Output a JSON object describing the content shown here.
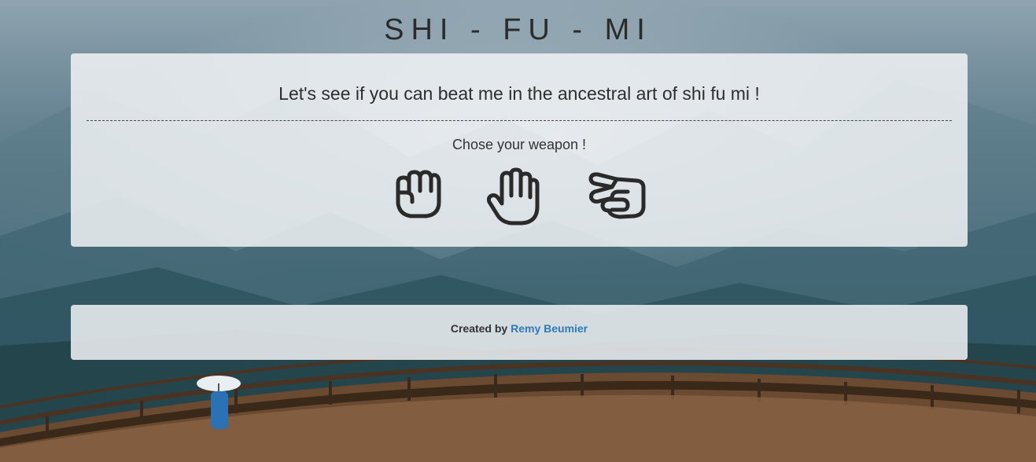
{
  "header": {
    "title": "SHI - FU - MI"
  },
  "game": {
    "intro": "Let's see if you can beat me in the ancestral art of shi fu mi !",
    "prompt": "Chose your weapon !",
    "weapons": [
      {
        "name": "rock",
        "icon": "fist-icon"
      },
      {
        "name": "paper",
        "icon": "open-hand-icon"
      },
      {
        "name": "scissors",
        "icon": "scissors-hand-icon"
      }
    ]
  },
  "footer": {
    "prefix": "Created by",
    "author": "Remy Beumier"
  },
  "colors": {
    "link": "#2e7ab6",
    "panel": "rgba(240,242,245,0.86)",
    "icon": "#2a2a2a"
  }
}
